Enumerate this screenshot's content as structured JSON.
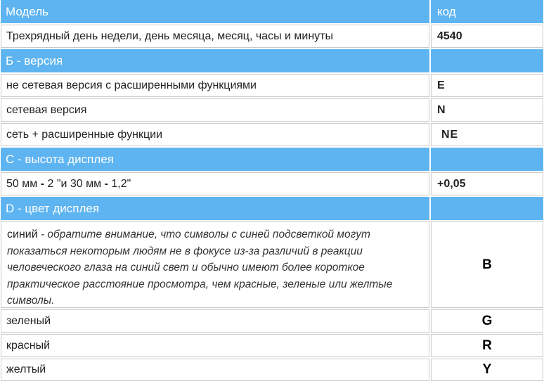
{
  "header": {
    "model": "Модель",
    "code": "код"
  },
  "model_row": {
    "label": "Трехрядный день недели, день месяца, месяц, часы и минуты",
    "code": "4540"
  },
  "section_b": {
    "title": "Б - версия",
    "rows": [
      {
        "label": "не сетевая версия с расширенными функциями",
        "code": "E"
      },
      {
        "label": "сетевая версия",
        "code": "N"
      },
      {
        "label": "сеть + расширенные функции",
        "code": "NE"
      }
    ]
  },
  "section_c": {
    "title": "С - высота дисплея",
    "row": {
      "label_a": "50 мм",
      "sep_a": " - ",
      "label_b": "2 \"и 30 мм",
      "sep_b": " - ",
      "label_c": "1,2\"",
      "code": "+0,05"
    }
  },
  "section_d": {
    "title": "D - цвет дисплея",
    "blue": {
      "lead": "синий",
      "note": " - обратите внимание, что символы с синей подсветкой могут показаться некоторым людям не в фокусе из-за различий в реакции человеческого глаза на синий свет и обычно имеют более короткое практическое расстояние просмотра, чем красные, зеленые или желтые символы.",
      "code": "B"
    },
    "rows": [
      {
        "label": "зеленый",
        "code": "G"
      },
      {
        "label": "красный",
        "code": "R"
      },
      {
        "label": "желтый",
        "code": "Y"
      }
    ]
  },
  "colors": {
    "header_bg": "#5db4f0",
    "border": "#c9c9c9"
  }
}
